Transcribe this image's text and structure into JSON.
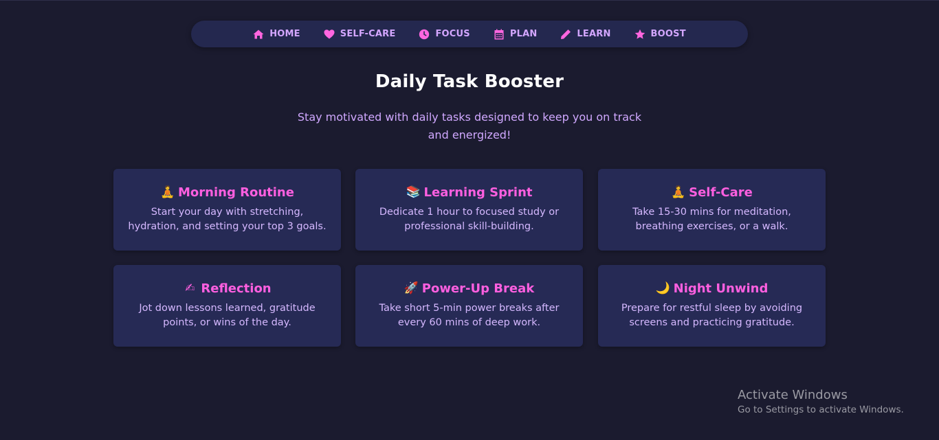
{
  "nav": {
    "items": [
      {
        "label": "HOME",
        "icon": "home-icon"
      },
      {
        "label": "SELF-CARE",
        "icon": "heart-icon"
      },
      {
        "label": "FOCUS",
        "icon": "clock-icon"
      },
      {
        "label": "PLAN",
        "icon": "calendar-icon"
      },
      {
        "label": "LEARN",
        "icon": "pencil-icon"
      },
      {
        "label": "BOOST",
        "icon": "star-icon"
      }
    ]
  },
  "header": {
    "title": "Daily Task Booster",
    "subtitle_line1": "Stay motivated with daily tasks designed to keep you on track",
    "subtitle_line2": "and energized!"
  },
  "cards": [
    {
      "emoji": "🧘",
      "title": "Morning Routine",
      "desc_line1": "Start your day with stretching,",
      "desc_line2": "hydration, and setting your top 3 goals."
    },
    {
      "emoji": "📚",
      "title": "Learning Sprint",
      "desc_line1": "Dedicate 1 hour to focused study or",
      "desc_line2": "professional skill-building."
    },
    {
      "emoji": "🧘",
      "title": "Self-Care",
      "desc_line1": "Take 15-30 mins for meditation,",
      "desc_line2": "breathing exercises, or a walk."
    },
    {
      "emoji": "✍",
      "title": "Reflection",
      "desc_line1": "Jot down lessons learned, gratitude",
      "desc_line2": "points, or wins of the day."
    },
    {
      "emoji": "🚀",
      "title": "Power-Up Break",
      "desc_line1": "Take short 5-min power breaks after",
      "desc_line2": "every 60 mins of deep work."
    },
    {
      "emoji": "🌙",
      "title": "Night Unwind",
      "desc_line1": "Prepare for restful sleep by avoiding",
      "desc_line2": "screens and practicing gratitude."
    }
  ],
  "watermark": {
    "line1": "Activate Windows",
    "line2": "Go to Settings to activate Windows."
  },
  "colors": {
    "background": "#1b1b2f",
    "panel": "#262a55",
    "accent": "#ff5fe0",
    "text_light": "#d5b8ff"
  }
}
